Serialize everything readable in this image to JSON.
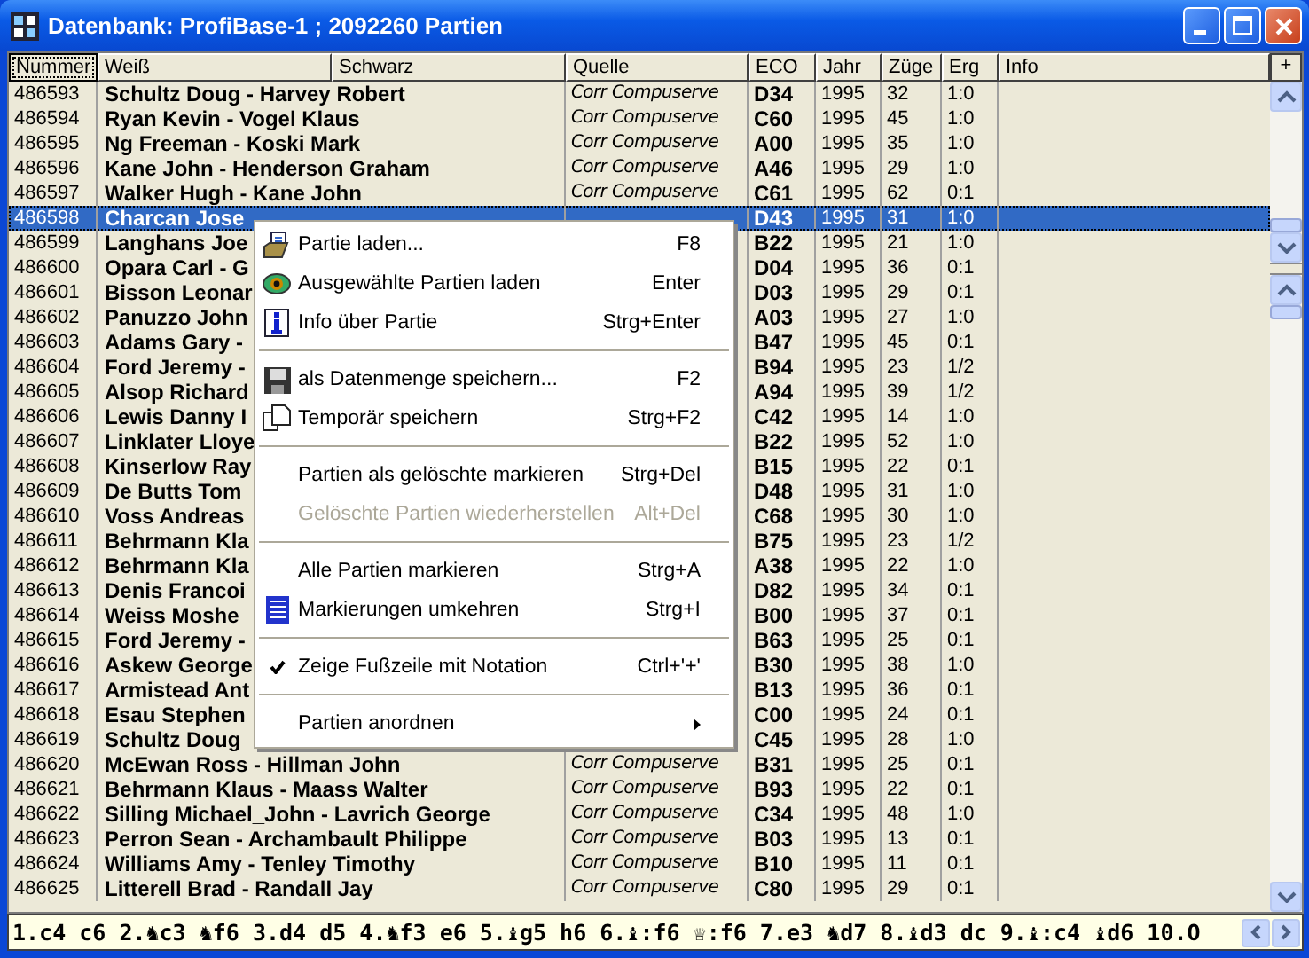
{
  "window": {
    "title": "Datenbank: ProfiBase-1 ; 2092260 Partien"
  },
  "columns": [
    {
      "label": "Nummer",
      "focused": true
    },
    {
      "label": "Weiß",
      "focused": false
    },
    {
      "label": "Schwarz",
      "focused": false
    },
    {
      "label": "Quelle",
      "focused": false
    },
    {
      "label": "ECO",
      "focused": false
    },
    {
      "label": "Jahr",
      "focused": false
    },
    {
      "label": "Züge",
      "focused": false
    },
    {
      "label": "Erg",
      "focused": false
    },
    {
      "label": "Info",
      "focused": false
    }
  ],
  "add_column_button": "+",
  "rows": [
    {
      "number": "486593",
      "players": "Schultz Doug - Harvey Robert",
      "source": "Corr Compuserve",
      "eco": "D34",
      "year": "1995",
      "moves": "32",
      "result": "1:0",
      "selected": false
    },
    {
      "number": "486594",
      "players": "Ryan Kevin - Vogel Klaus",
      "source": "Corr Compuserve",
      "eco": "C60",
      "year": "1995",
      "moves": "45",
      "result": "1:0",
      "selected": false
    },
    {
      "number": "486595",
      "players": "Ng Freeman - Koski Mark",
      "source": "Corr Compuserve",
      "eco": "A00",
      "year": "1995",
      "moves": "35",
      "result": "1:0",
      "selected": false
    },
    {
      "number": "486596",
      "players": "Kane John - Henderson Graham",
      "source": "Corr Compuserve",
      "eco": "A46",
      "year": "1995",
      "moves": "29",
      "result": "1:0",
      "selected": false
    },
    {
      "number": "486597",
      "players": "Walker Hugh - Kane John",
      "source": "Corr Compuserve",
      "eco": "C61",
      "year": "1995",
      "moves": "62",
      "result": "0:1",
      "selected": false
    },
    {
      "number": "486598",
      "players": "Charcan Jose",
      "eco": "D43",
      "year": "1995",
      "moves": "31",
      "result": "1:0",
      "selected": true
    },
    {
      "number": "486599",
      "players": "Langhans Joe",
      "eco": "B22",
      "year": "1995",
      "moves": "21",
      "result": "1:0",
      "selected": false
    },
    {
      "number": "486600",
      "players": "Opara Carl - G",
      "eco": "D04",
      "year": "1995",
      "moves": "36",
      "result": "0:1",
      "selected": false
    },
    {
      "number": "486601",
      "players": "Bisson Leonar",
      "eco": "D03",
      "year": "1995",
      "moves": "29",
      "result": "0:1",
      "selected": false
    },
    {
      "number": "486602",
      "players": "Panuzzo John",
      "eco": "A03",
      "year": "1995",
      "moves": "27",
      "result": "1:0",
      "selected": false
    },
    {
      "number": "486603",
      "players": "Adams Gary -",
      "eco": "B47",
      "year": "1995",
      "moves": "45",
      "result": "0:1",
      "selected": false
    },
    {
      "number": "486604",
      "players": "Ford Jeremy -",
      "eco": "B94",
      "year": "1995",
      "moves": "23",
      "result": "1/2",
      "selected": false
    },
    {
      "number": "486605",
      "players": "Alsop Richard",
      "eco": "A94",
      "year": "1995",
      "moves": "39",
      "result": "1/2",
      "selected": false
    },
    {
      "number": "486606",
      "players": "Lewis Danny I",
      "eco": "C42",
      "year": "1995",
      "moves": "14",
      "result": "1:0",
      "selected": false
    },
    {
      "number": "486607",
      "players": "Linklater Lloye",
      "eco": "B22",
      "year": "1995",
      "moves": "52",
      "result": "1:0",
      "selected": false
    },
    {
      "number": "486608",
      "players": "Kinserlow Ray",
      "eco": "B15",
      "year": "1995",
      "moves": "22",
      "result": "0:1",
      "selected": false
    },
    {
      "number": "486609",
      "players": "De Butts Tom",
      "eco": "D48",
      "year": "1995",
      "moves": "31",
      "result": "1:0",
      "selected": false
    },
    {
      "number": "486610",
      "players": "Voss Andreas",
      "eco": "C68",
      "year": "1995",
      "moves": "30",
      "result": "1:0",
      "selected": false
    },
    {
      "number": "486611",
      "players": "Behrmann Kla",
      "eco": "B75",
      "year": "1995",
      "moves": "23",
      "result": "1/2",
      "selected": false
    },
    {
      "number": "486612",
      "players": "Behrmann Kla",
      "eco": "A38",
      "year": "1995",
      "moves": "22",
      "result": "1:0",
      "selected": false
    },
    {
      "number": "486613",
      "players": "Denis Francoi",
      "eco": "D82",
      "year": "1995",
      "moves": "34",
      "result": "0:1",
      "selected": false
    },
    {
      "number": "486614",
      "players": "Weiss Moshe",
      "eco": "B00",
      "year": "1995",
      "moves": "37",
      "result": "0:1",
      "selected": false
    },
    {
      "number": "486615",
      "players": "Ford Jeremy -",
      "eco": "B63",
      "year": "1995",
      "moves": "25",
      "result": "0:1",
      "selected": false
    },
    {
      "number": "486616",
      "players": "Askew George",
      "eco": "B30",
      "year": "1995",
      "moves": "38",
      "result": "1:0",
      "selected": false
    },
    {
      "number": "486617",
      "players": "Armistead Ant",
      "eco": "B13",
      "year": "1995",
      "moves": "36",
      "result": "0:1",
      "selected": false
    },
    {
      "number": "486618",
      "players": "Esau Stephen",
      "eco": "C00",
      "year": "1995",
      "moves": "24",
      "result": "0:1",
      "selected": false
    },
    {
      "number": "486619",
      "players": "Schultz Doug",
      "eco": "C45",
      "year": "1995",
      "moves": "28",
      "result": "1:0",
      "selected": false
    },
    {
      "number": "486620",
      "players": "McEwan Ross - Hillman John",
      "source": "Corr Compuserve",
      "eco": "B31",
      "year": "1995",
      "moves": "25",
      "result": "0:1",
      "selected": false
    },
    {
      "number": "486621",
      "players": "Behrmann Klaus - Maass Walter",
      "source": "Corr Compuserve",
      "eco": "B93",
      "year": "1995",
      "moves": "22",
      "result": "0:1",
      "selected": false
    },
    {
      "number": "486622",
      "players": "Silling Michael_John - Lavrich George",
      "source": "Corr Compuserve",
      "eco": "C34",
      "year": "1995",
      "moves": "48",
      "result": "1:0",
      "selected": false
    },
    {
      "number": "486623",
      "players": "Perron Sean - Archambault Philippe",
      "source": "Corr Compuserve",
      "eco": "B03",
      "year": "1995",
      "moves": "13",
      "result": "0:1",
      "selected": false
    },
    {
      "number": "486624",
      "players": "Williams Amy - Tenley Timothy",
      "source": "Corr Compuserve",
      "eco": "B10",
      "year": "1995",
      "moves": "11",
      "result": "0:1",
      "selected": false
    },
    {
      "number": "486625",
      "players": "Litterell Brad - Randall Jay",
      "source": "Corr Compuserve",
      "eco": "C80",
      "year": "1995",
      "moves": "29",
      "result": "0:1",
      "selected": false
    }
  ],
  "context_menu": {
    "items": [
      {
        "kind": "item",
        "label": "Partie laden...",
        "shortcut": "F8",
        "disabled": false,
        "checked": false,
        "submenu": false
      },
      {
        "kind": "item",
        "label": "Ausgewählte Partien laden",
        "shortcut": "Enter",
        "disabled": false,
        "checked": false,
        "submenu": false
      },
      {
        "kind": "item",
        "label": "Info über Partie",
        "shortcut": "Strg+Enter",
        "disabled": false,
        "checked": false,
        "submenu": false
      },
      {
        "kind": "separator"
      },
      {
        "kind": "item",
        "label": "als Datenmenge speichern...",
        "shortcut": "F2",
        "disabled": false,
        "checked": false,
        "submenu": false
      },
      {
        "kind": "item",
        "label": "Temporär speichern",
        "shortcut": "Strg+F2",
        "disabled": false,
        "checked": false,
        "submenu": false
      },
      {
        "kind": "separator"
      },
      {
        "kind": "item",
        "label": "Partien als gelöschte markieren",
        "shortcut": "Strg+Del",
        "disabled": false,
        "checked": false,
        "submenu": false
      },
      {
        "kind": "item",
        "label": "Gelöschte Partien wiederherstellen",
        "shortcut": "Alt+Del",
        "disabled": true,
        "checked": false,
        "submenu": false
      },
      {
        "kind": "separator"
      },
      {
        "kind": "item",
        "label": "Alle Partien markieren",
        "shortcut": "Strg+A",
        "disabled": false,
        "checked": false,
        "submenu": false
      },
      {
        "kind": "item",
        "label": "Markierungen umkehren",
        "shortcut": "Strg+I",
        "disabled": false,
        "checked": false,
        "submenu": false
      },
      {
        "kind": "separator"
      },
      {
        "kind": "item",
        "label": "Zeige Fußzeile mit Notation",
        "shortcut": "Ctrl+'+'",
        "disabled": false,
        "checked": true,
        "submenu": false
      },
      {
        "kind": "separator"
      },
      {
        "kind": "item",
        "label": "Partien anordnen",
        "disabled": false,
        "checked": false,
        "submenu": true
      }
    ]
  },
  "notation": "1.c4 c6 2.♞c3 ♞f6 3.d4 d5 4.♞f3 e6 5.♝g5 h6 6.♝:f6 ♕:f6 7.e3 ♞d7 8.♝d3 dc 9.♝:c4 ♝d6 10.O"
}
